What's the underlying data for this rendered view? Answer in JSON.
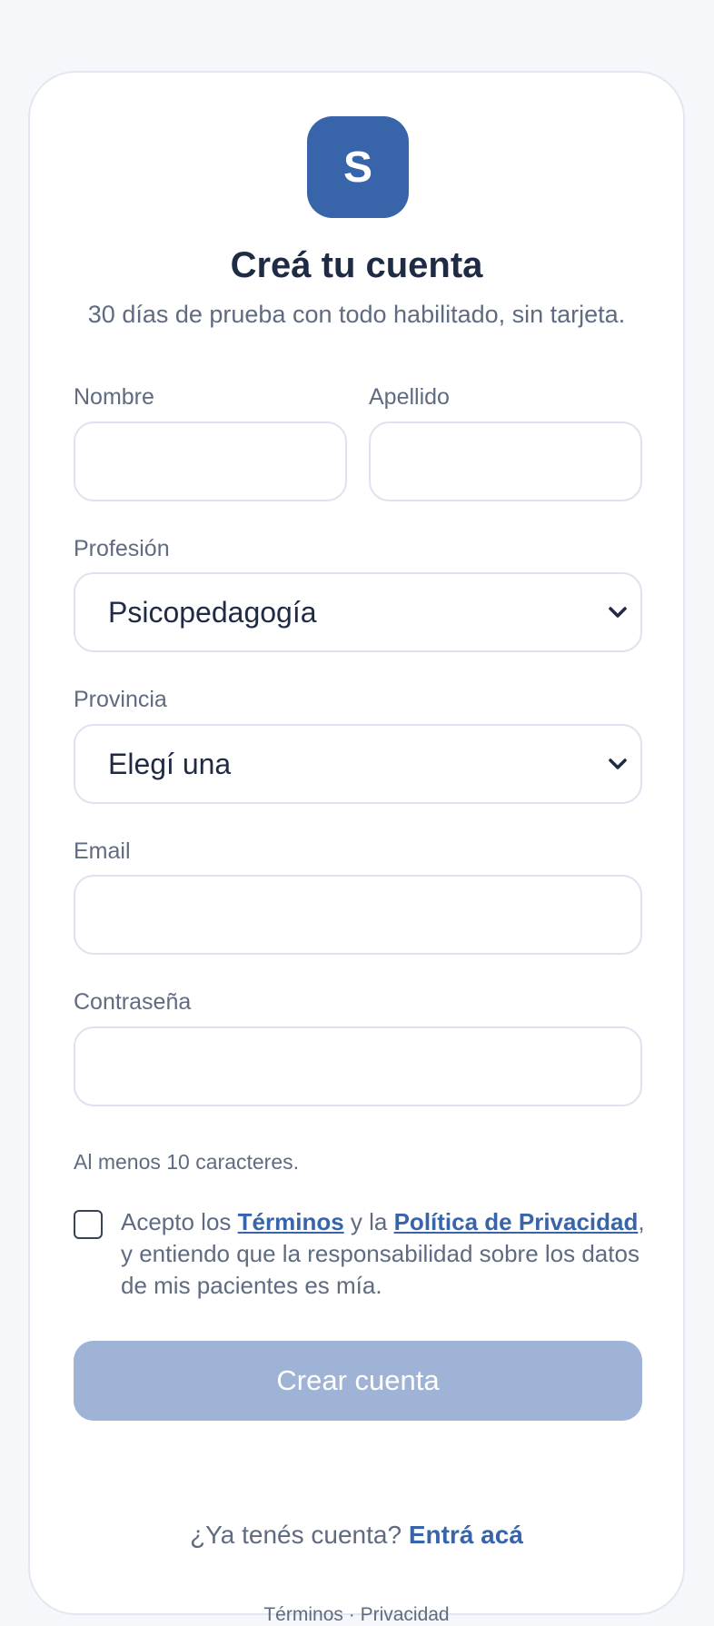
{
  "brand": {
    "logo_letter": "S",
    "accent_color": "#3864aa"
  },
  "header": {
    "title": "Creá tu cuenta",
    "subtitle": "30 días de prueba con todo habilitado, sin tarjeta."
  },
  "form": {
    "first_name": {
      "label": "Nombre",
      "value": ""
    },
    "last_name": {
      "label": "Apellido",
      "value": ""
    },
    "profession": {
      "label": "Profesión",
      "selected": "Psicopedagogía",
      "icon": "chevron-down-icon"
    },
    "province": {
      "label": "Provincia",
      "selected": "Elegí una",
      "icon": "chevron-down-icon"
    },
    "email": {
      "label": "Email",
      "value": ""
    },
    "password": {
      "label": "Contraseña",
      "value": "",
      "hint": "Al menos 10 caracteres."
    },
    "consent": {
      "checked": false,
      "text_1": "Acepto los ",
      "terms_link": "Términos",
      "text_2": " y la ",
      "privacy_link": "Política de Privacidad",
      "text_3": ", y entiendo que la responsabilidad sobre los datos de mis pacientes es mía."
    },
    "submit_label": "Crear cuenta",
    "submit_color": "#9fb3d6"
  },
  "login": {
    "prompt": "¿Ya tenés cuenta? ",
    "link": "Entrá acá"
  },
  "footer": {
    "terms": "Términos",
    "separator": " · ",
    "privacy": "Privacidad"
  }
}
